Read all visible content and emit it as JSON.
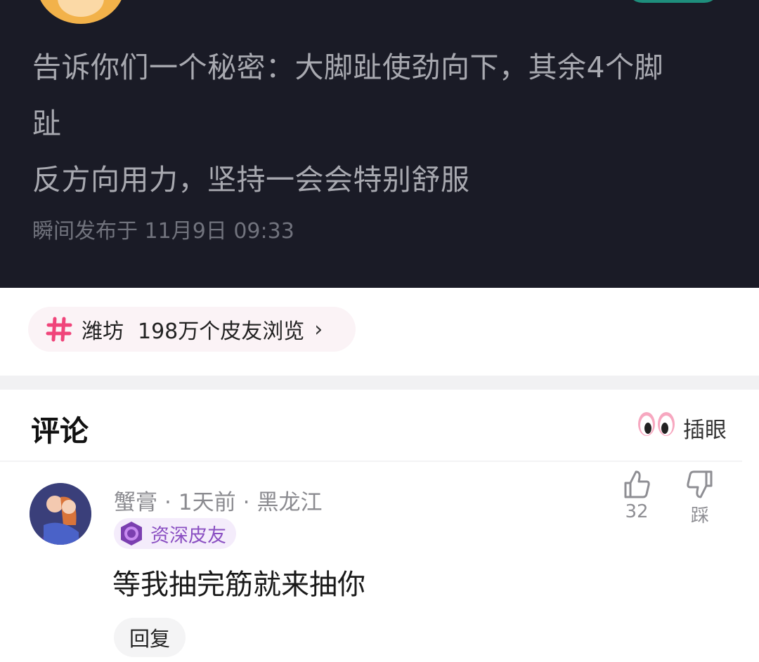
{
  "post": {
    "lines": [
      "告诉你们一个秘密：大脚趾使劲向下，其余4个脚",
      "趾",
      "反方向用力，坚持一会会特别舒服"
    ],
    "time": "瞬间发布于 11月9日 09:33"
  },
  "topic": {
    "name": "潍坊",
    "views": "198万个皮友浏览",
    "chevron": "›"
  },
  "comments": {
    "title": "评论",
    "peek_label": "插眼",
    "items": [
      {
        "username": "蟹膏",
        "time": "1天前",
        "location": "黑龙江",
        "separator": "·",
        "badge": "资深皮友",
        "text": "等我抽完筋就来抽你",
        "reply_label": "回复",
        "like_count": "32",
        "dislike_label": "踩"
      }
    ]
  },
  "colors": {
    "post_bg": "#1a1b26",
    "accent_pink": "#f0447a",
    "badge_purple": "#8a4fc2"
  }
}
